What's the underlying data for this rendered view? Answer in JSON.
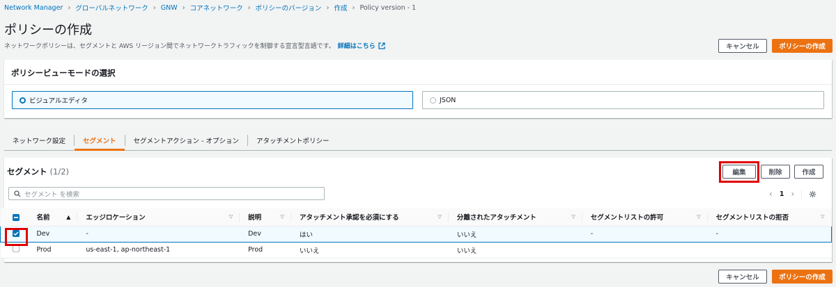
{
  "breadcrumb": {
    "items": [
      "Network Manager",
      "グローバルネットワーク",
      "GNW",
      "コアネットワーク",
      "ポリシーのバージョン",
      "作成"
    ],
    "current": "Policy version - 1"
  },
  "page": {
    "title": "ポリシーの作成",
    "description": "ネットワークポリシーは、セグメントと AWS リージョン間でネットワークトラフィックを制御する宣言型言語です。",
    "details_link": "詳細はこちら"
  },
  "header_buttons": {
    "cancel": "キャンセル",
    "create": "ポリシーの作成"
  },
  "view_mode": {
    "title": "ポリシービューモードの選択",
    "options": [
      {
        "label": "ビジュアルエディタ",
        "selected": true
      },
      {
        "label": "JSON",
        "selected": false
      }
    ]
  },
  "tabs": [
    {
      "label": "ネットワーク設定",
      "active": false
    },
    {
      "label": "セグメント",
      "active": true
    },
    {
      "label": "セグメントアクション - オプション",
      "active": false
    },
    {
      "label": "アタッチメントポリシー",
      "active": false
    }
  ],
  "segments": {
    "title": "セグメント",
    "count": "(1/2)",
    "buttons": {
      "edit": "編集",
      "delete": "削除",
      "create": "作成"
    },
    "search_placeholder": "セグメント を検索",
    "page": "1",
    "columns": [
      "名前",
      "エッジロケーション",
      "説明",
      "アタッチメント承認を必須にする",
      "分離されたアタッチメント",
      "セグメントリストの許可",
      "セグメントリストの拒否"
    ],
    "rows": [
      {
        "selected": true,
        "cells": [
          "Dev",
          "-",
          "Dev",
          "はい",
          "いいえ",
          "-",
          "-"
        ]
      },
      {
        "selected": false,
        "cells": [
          "Prod",
          "us-east-1, ap-northeast-1",
          "Prod",
          "いいえ",
          "いいえ",
          "",
          ""
        ]
      }
    ]
  },
  "footer_buttons": {
    "cancel": "キャンセル",
    "create": "ポリシーの作成"
  },
  "colors": {
    "accent": "#ec7211",
    "link": "#0073bb",
    "highlight": "#e00000"
  }
}
